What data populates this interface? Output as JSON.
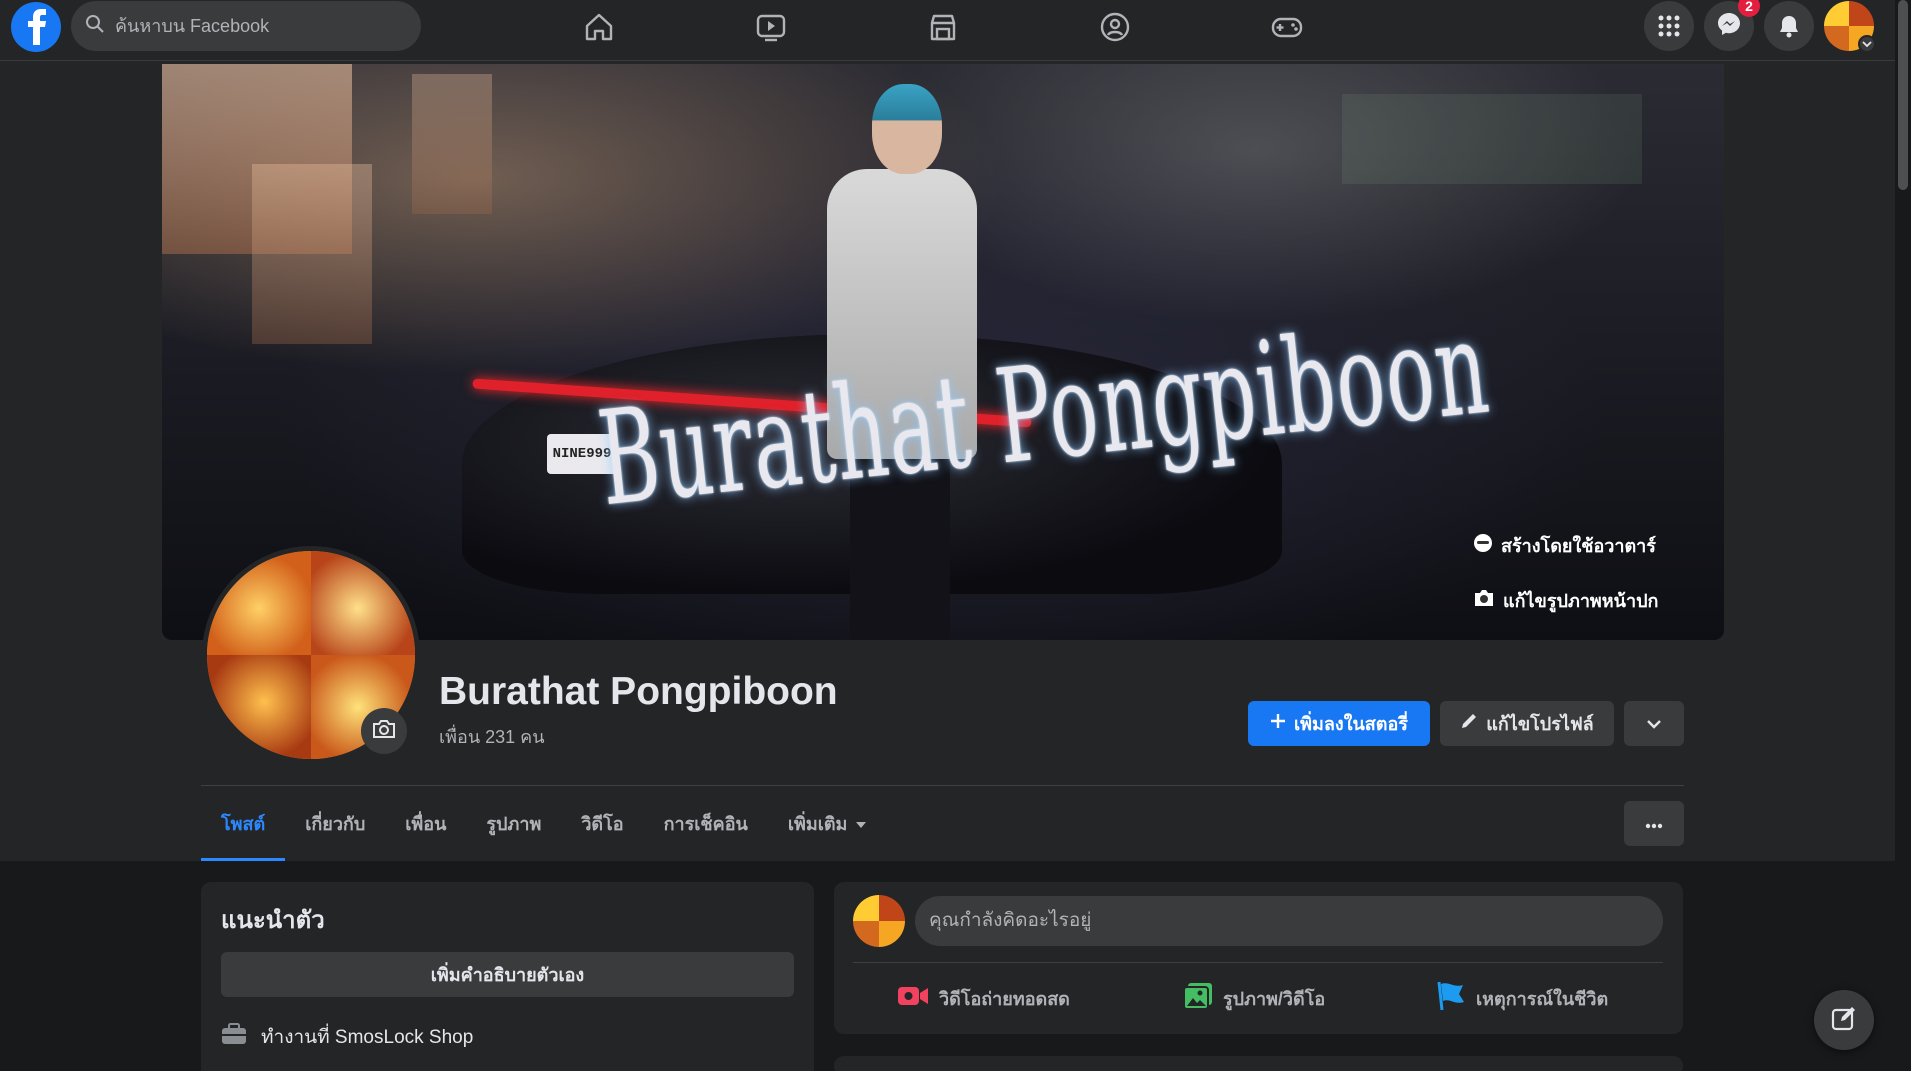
{
  "topbar": {
    "search_placeholder": "ค้นหาบน Facebook",
    "nav_icons": [
      "home-icon",
      "watch-icon",
      "marketplace-icon",
      "groups-icon",
      "gaming-icon"
    ],
    "messenger_badge": "2"
  },
  "cover": {
    "title_art": "Burathat Pongpiboon",
    "plate": "NINE999",
    "avatar_action": "สร้างโดยใช้อวาตาร์",
    "edit_cover": "แก้ไขรูปภาพหน้าปก"
  },
  "profile": {
    "name": "Burathat Pongpiboon",
    "friends": "เพื่อน 231 คน",
    "add_story": "เพิ่มลงในสตอรี่",
    "edit_profile": "แก้ไขโปรไฟล์"
  },
  "tabs": [
    {
      "label": "โพสต์",
      "active": true
    },
    {
      "label": "เกี่ยวกับ"
    },
    {
      "label": "เพื่อน"
    },
    {
      "label": "รูปภาพ"
    },
    {
      "label": "วิดีโอ"
    },
    {
      "label": "การเช็คอิน"
    },
    {
      "label": "เพิ่มเติม"
    }
  ],
  "intro": {
    "title": "แนะนำตัว",
    "add_bio": "เพิ่มคำอธิบายตัวเอง",
    "work": "ทำงานที่ SmosLock Shop"
  },
  "composer": {
    "placeholder": "คุณกำลังคิดอะไรอยู่",
    "live_video": "วิดีโอถ่ายทอดสด",
    "photo_video": "รูปภาพ/วิดีโอ",
    "life_event": "เหตุการณ์ในชีวิต"
  },
  "colors": {
    "accent": "#1877f2",
    "active_tab": "#2d88ff",
    "badge": "#e41e3f",
    "live": "#f3425f",
    "photo": "#45bd62",
    "event": "#1d9bf0"
  }
}
